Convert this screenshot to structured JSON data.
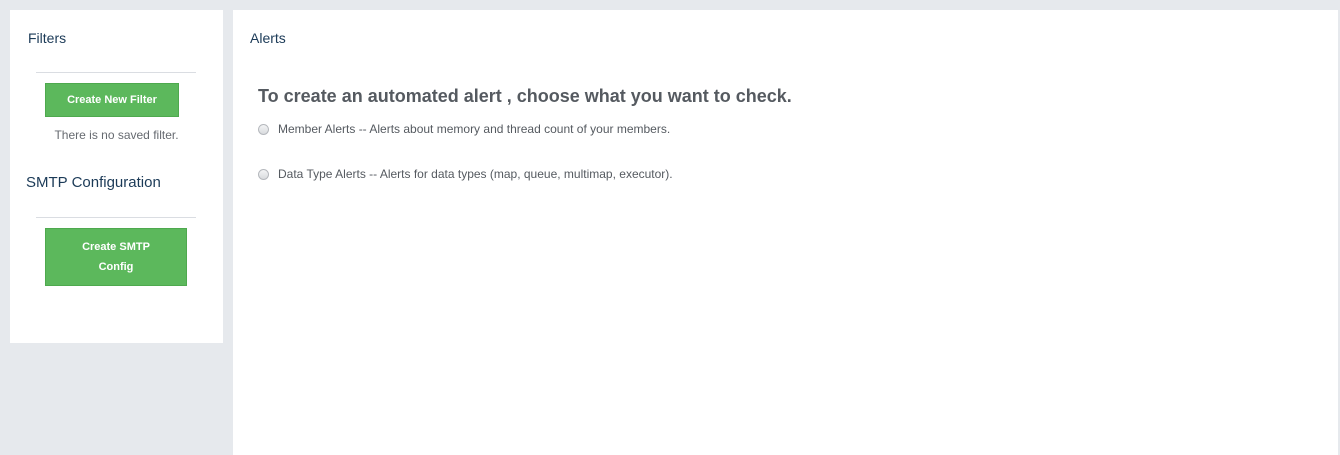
{
  "sidebar": {
    "filters_title": "Filters",
    "create_filter_label": "Create New Filter",
    "no_filter_text": "There is no saved filter.",
    "smtp_title": "SMTP Configuration",
    "create_smtp_label_line1": "Create SMTP",
    "create_smtp_label_line2": "Config"
  },
  "main": {
    "title": "Alerts",
    "headline": "To create an automated alert , choose what you want to check.",
    "options": [
      {
        "label": "Member Alerts -- Alerts about memory and thread count of your members.",
        "selected": false
      },
      {
        "label": "Data Type Alerts -- Alerts for data types (map, queue, multimap, executor).",
        "selected": false
      }
    ]
  },
  "colors": {
    "accent_green": "#5cb85c",
    "heading_blue": "#1b3a57",
    "background": "#e6e9ed"
  }
}
